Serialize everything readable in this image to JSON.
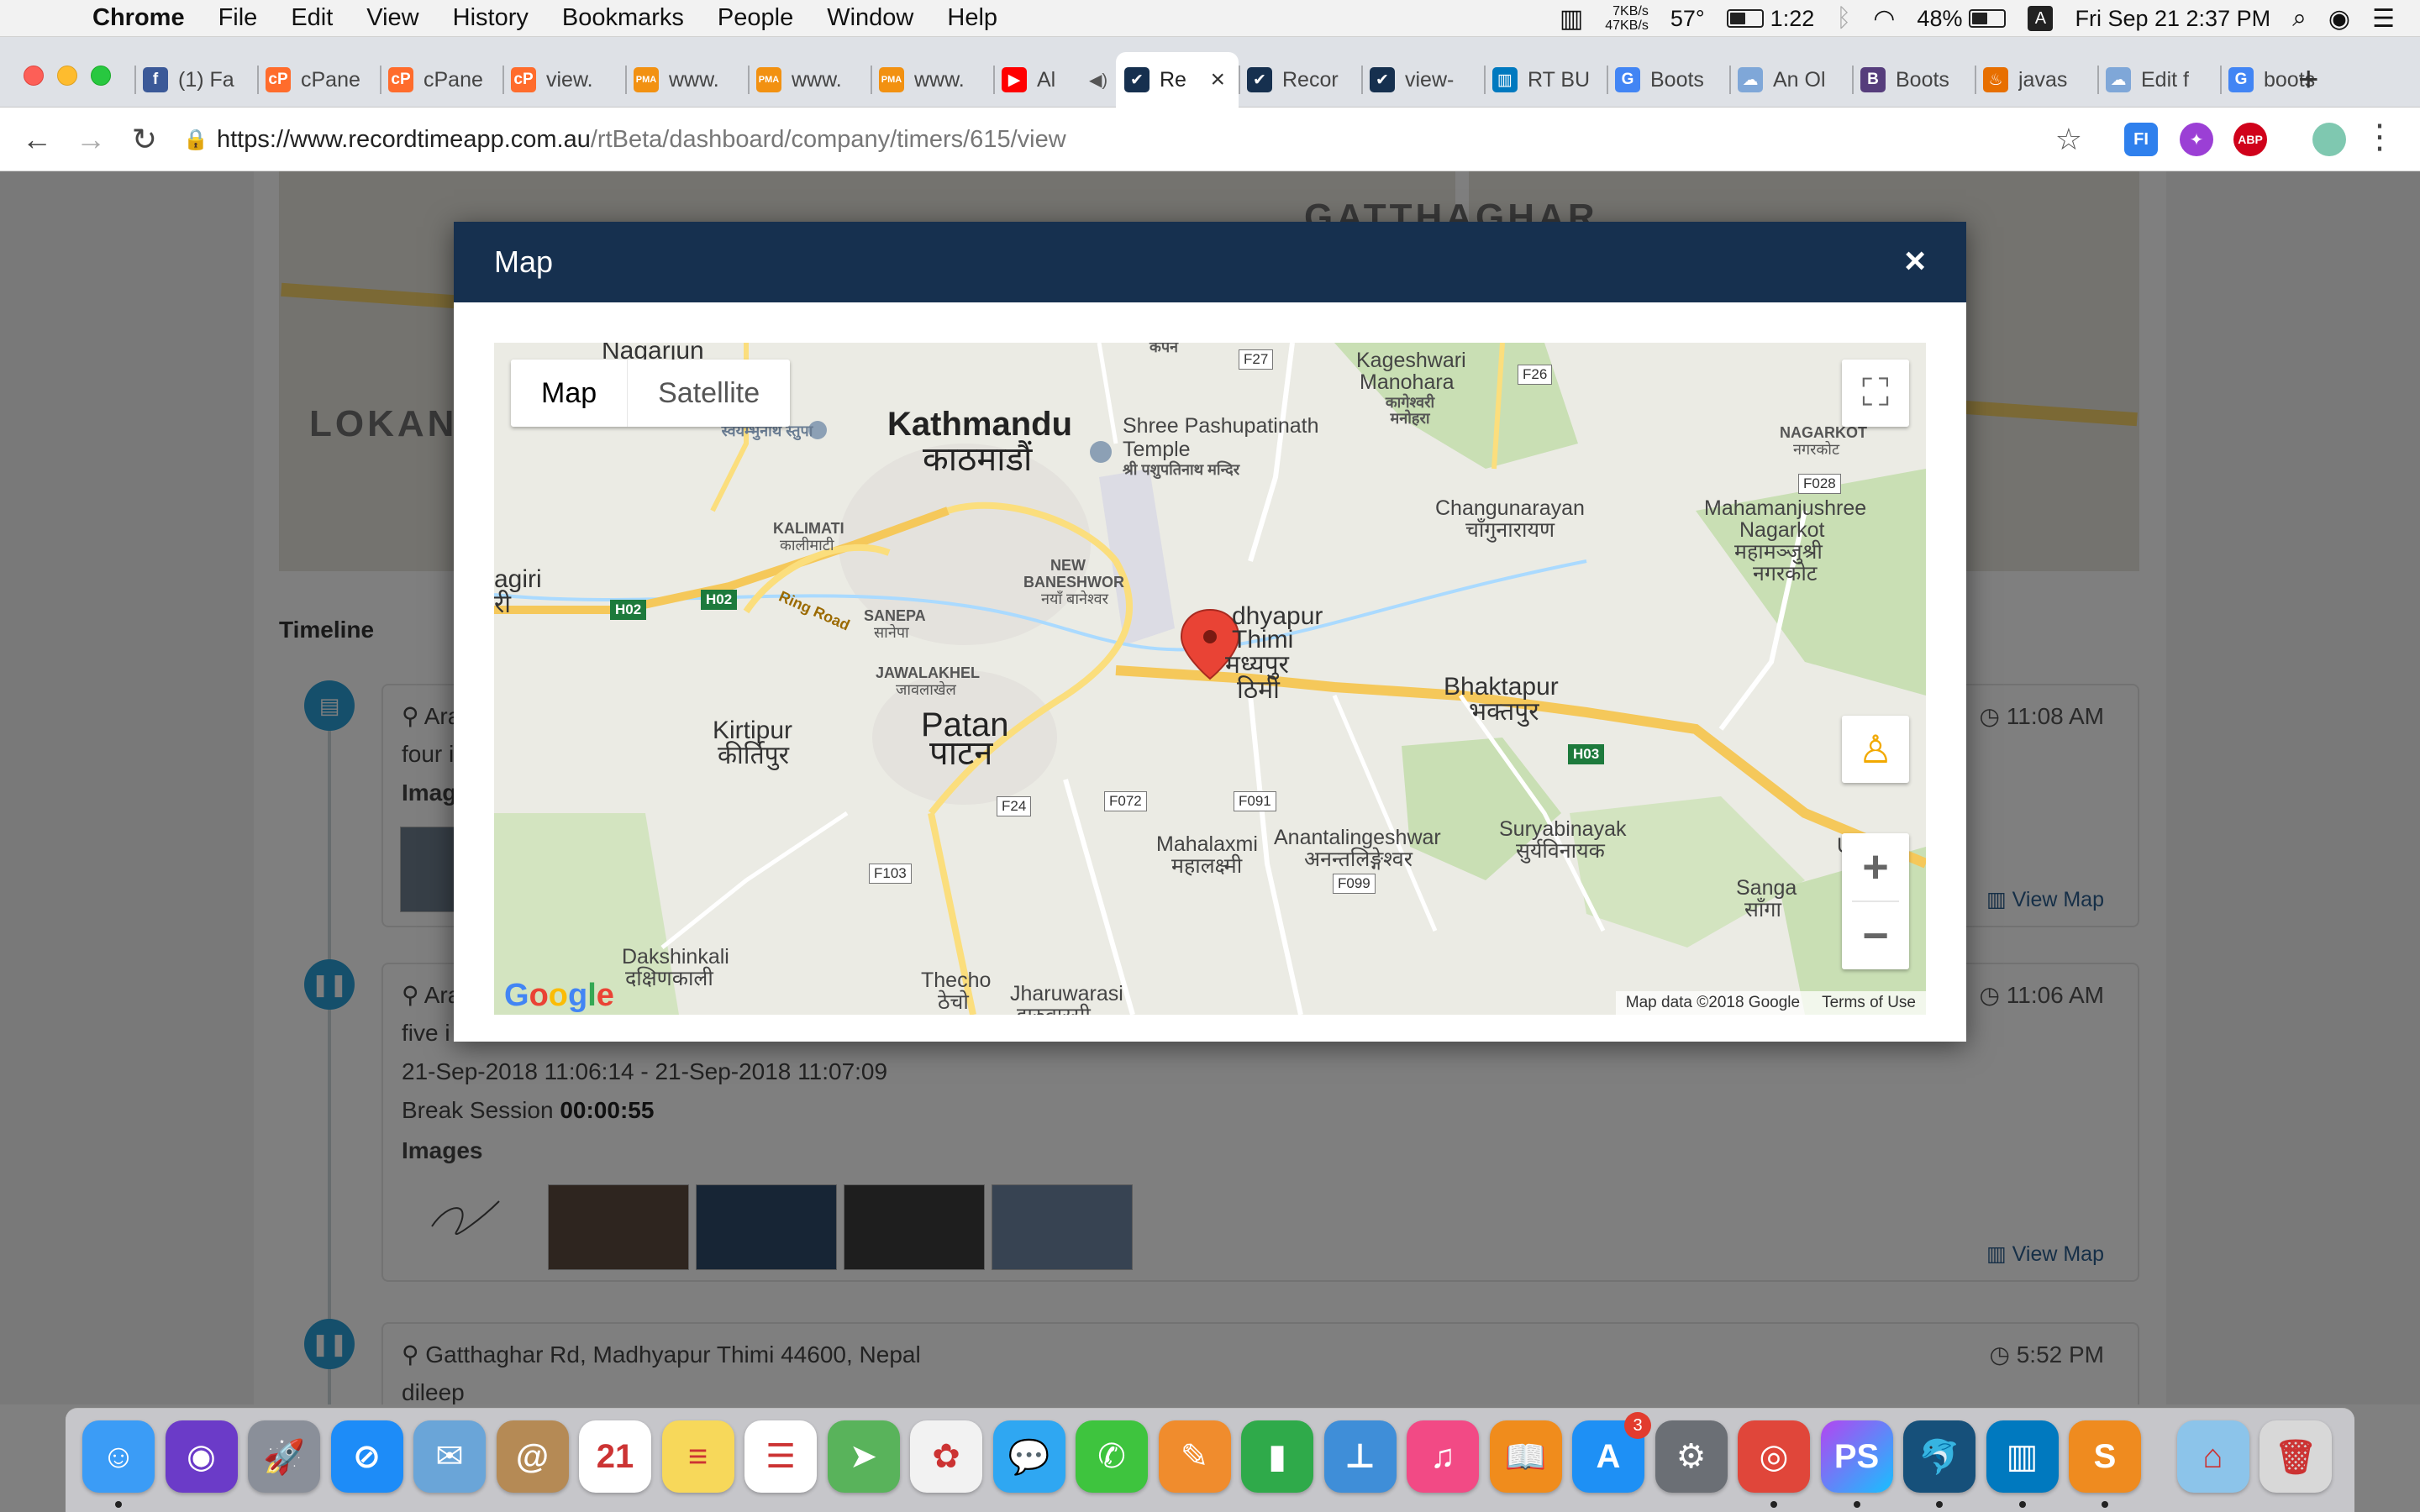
{
  "menubar": {
    "apple": "",
    "items": [
      "Chrome",
      "File",
      "Edit",
      "View",
      "History",
      "Bookmarks",
      "People",
      "Window",
      "Help"
    ],
    "netspeed_up": "7KB/s",
    "netspeed_down": "47KB/s",
    "temperature": "57°",
    "battery_time": "1:22",
    "battery_percent": "48%",
    "input_source": "A",
    "datetime": "Fri Sep 21  2:37 PM"
  },
  "tabs": [
    {
      "title": "(1) Fa",
      "favicon": "facebook-icon",
      "color": "#3b5998",
      "glyph": "f"
    },
    {
      "title": "cPane",
      "favicon": "cpanel-icon",
      "color": "#ff6c2c",
      "glyph": "cP"
    },
    {
      "title": "cPane",
      "favicon": "cpanel-icon",
      "color": "#ff6c2c",
      "glyph": "cP"
    },
    {
      "title": "view.",
      "favicon": "cpanel-icon",
      "color": "#ff6c2c",
      "glyph": "cP"
    },
    {
      "title": "www.",
      "favicon": "phpmyadmin-icon",
      "color": "#f29111",
      "glyph": "PMA"
    },
    {
      "title": "www.",
      "favicon": "phpmyadmin-icon",
      "color": "#f29111",
      "glyph": "PMA"
    },
    {
      "title": "www.",
      "favicon": "phpmyadmin-icon",
      "color": "#f29111",
      "glyph": "PMA"
    },
    {
      "title": "Al",
      "favicon": "youtube-icon",
      "color": "#ff0000",
      "glyph": "▶"
    },
    {
      "title": "Re",
      "favicon": "recordtime-icon",
      "color": "#16304f",
      "glyph": "✔",
      "active": true
    },
    {
      "title": "Recor",
      "favicon": "recordtime-icon",
      "color": "#16304f",
      "glyph": "✔"
    },
    {
      "title": "view-",
      "favicon": "recordtime-icon",
      "color": "#16304f",
      "glyph": "✔"
    },
    {
      "title": "RT BU",
      "favicon": "trello-icon",
      "color": "#0079bf",
      "glyph": "▥"
    },
    {
      "title": "Boots",
      "favicon": "google-icon",
      "color": "#4285f4",
      "glyph": "G"
    },
    {
      "title": "An Ol",
      "favicon": "cloud-icon",
      "color": "#7fa7d8",
      "glyph": "☁"
    },
    {
      "title": "Boots",
      "favicon": "bootstrap-icon",
      "color": "#563d7c",
      "glyph": "B"
    },
    {
      "title": "javas",
      "favicon": "java-icon",
      "color": "#e76f00",
      "glyph": "♨"
    },
    {
      "title": "Edit f",
      "favicon": "cloud-icon",
      "color": "#7fa7d8",
      "glyph": "☁"
    },
    {
      "title": "boots",
      "favicon": "google-icon",
      "color": "#4285f4",
      "glyph": "G"
    }
  ],
  "address": {
    "host": "https://www.recordtimeapp.com.au",
    "path": "/rtBeta/dashboard/company/timers/615/view"
  },
  "background_page": {
    "map_labels": [
      "GATTHAGHAR",
      "LOKAN"
    ],
    "timeline_title": "Timeline",
    "entries": [
      {
        "location": "Ara",
        "time": "11:08 AM",
        "line1": "four i",
        "images_label": "Image",
        "view_map": "View Map"
      },
      {
        "location": "Ara",
        "time": "11:06 AM",
        "line1": "five i",
        "range": "21-Sep-2018 11:06:14 - 21-Sep-2018 11:07:09",
        "break_label": "Break Session",
        "break_value": "00:00:55",
        "images_label": "Images",
        "view_map": "View Map"
      },
      {
        "location": "Gatthaghar Rd, Madhyapur Thimi 44600, Nepal",
        "time": "5:52 PM",
        "line1": "dileep"
      }
    ]
  },
  "modal": {
    "title": "Map",
    "close": "×",
    "map_type": {
      "map": "Map",
      "satellite": "Satellite"
    },
    "attribution": {
      "data": "Map data ©2018 Google",
      "terms": "Terms of Use"
    },
    "labels": {
      "nagarjun": "Nagarjun",
      "kathmandu": "Kathmandu",
      "kathmandu_ne": "काठमाडौं",
      "swayambhu": "स्वयम्भुनाथ स्तुपा",
      "pashupatinath": "Shree Pashupatinath",
      "temple": "Temple",
      "pashupatinath_ne": "श्री पशुपतिनाथ मन्दिर",
      "kageshwari": "Kageshwari",
      "manohara": "Manohara",
      "kageshwari_ne": "कागेश्वरी मनोहरा",
      "nagarkot_sm": "NAGARKOT",
      "nagarkot_sm_ne": "नगरकोट",
      "changunarayan": "Changunarayan",
      "changunarayan_ne": "चाँगुनारायण",
      "mahamanjushree": "Mahamanjushree",
      "nagarkot": "Nagarkot",
      "mahamanjushree_ne": "महामञ्जुश्री",
      "nagarkot_ne": "नगरकोट",
      "kalimati": "KALIMATI",
      "kalimati_ne": "कालीमाटी",
      "new_baneshwor": "NEW",
      "new_baneshwor2": "BANESHWOR",
      "new_baneshwor_ne": "नयाँ बानेश्वर",
      "nagiri": "agiri",
      "nagiri_ne": "री",
      "ring_road": "Ring Road",
      "sanepa": "SANEPA",
      "sanepa_ne": "सानेपा",
      "jawalakhel": "JAWALAKHEL",
      "jawalakhel_ne": "जावलाखेल",
      "madhyapur": "dhyapur",
      "thimi": "Thimi",
      "madhyapur_ne": "मध्यपुर",
      "thimi_ne": "ठिमी",
      "bhaktapur": "Bhaktapur",
      "bhaktapur_ne": "भक्तपुर",
      "kirtipur": "Kirtipur",
      "kirtipur_ne": "कीर्तिपुर",
      "patan": "Patan",
      "patan_ne": "पाटन",
      "mahalaxmi": "Mahalaxmi",
      "mahalaxmi_ne": "महालक्ष्मी",
      "anantalingeshwar": "Anantalingeshwar",
      "anantalingeshwar_ne": "अनन्तलिङ्गेश्वर",
      "suryabinayak": "Suryabinayak",
      "suryabinayak_ne": "सुर्यविनायक",
      "sanga": "Sanga",
      "sanga_ne": "साँगा",
      "dakshinkali": "Dakshinkali",
      "dakshinkali_ne": "दक्षिणकाली",
      "thecho": "Thecho",
      "thecho_ne": "ठेचो",
      "jharuwarasi": "Jharuwarasi",
      "jharuwarasi_ne": "झरुवारसी",
      "ugrachandi": "U",
      "kapan": "कपन"
    },
    "shields": [
      "F27",
      "F26",
      "F028",
      "H02",
      "H02",
      "H03",
      "F24",
      "F072",
      "F091",
      "F103",
      "F099"
    ]
  },
  "dock": [
    {
      "name": "finder-icon",
      "color": "#3b9cf6",
      "glyph": "☺",
      "running": true
    },
    {
      "name": "siri-icon",
      "color": "#6b3bc8",
      "glyph": "◉"
    },
    {
      "name": "launchpad-icon",
      "color": "#8a8f99",
      "glyph": "🚀"
    },
    {
      "name": "safari-icon",
      "color": "#1d8cf8",
      "glyph": "⊘"
    },
    {
      "name": "mail-icon",
      "color": "#6aa5d8",
      "glyph": "✉"
    },
    {
      "name": "contacts-icon",
      "color": "#b58a55",
      "glyph": "@"
    },
    {
      "name": "calendar-icon",
      "color": "#ffffff",
      "glyph": "21"
    },
    {
      "name": "notes-icon",
      "color": "#f7d85a",
      "glyph": "≡"
    },
    {
      "name": "reminders-icon",
      "color": "#ffffff",
      "glyph": "☰"
    },
    {
      "name": "maps-icon",
      "color": "#59b35b",
      "glyph": "➤"
    },
    {
      "name": "photos-icon",
      "color": "#f2f2f2",
      "glyph": "✿"
    },
    {
      "name": "messages-icon",
      "color": "#2fa7f2",
      "glyph": "💬"
    },
    {
      "name": "facetime-icon",
      "color": "#3ec43e",
      "glyph": "✆"
    },
    {
      "name": "pages-icon",
      "color": "#f08c2d",
      "glyph": "✎"
    },
    {
      "name": "numbers-icon",
      "color": "#2faa4a",
      "glyph": "▮"
    },
    {
      "name": "keynote-icon",
      "color": "#3f8ed8",
      "glyph": "⊥"
    },
    {
      "name": "itunes-icon",
      "color": "#f24a85",
      "glyph": "♫"
    },
    {
      "name": "ibooks-icon",
      "color": "#f08c1c",
      "glyph": "📖"
    },
    {
      "name": "app-store-icon",
      "color": "#1e90f5",
      "glyph": "A",
      "badge": "3"
    },
    {
      "name": "system-preferences-icon",
      "color": "#6b6f75",
      "glyph": "⚙"
    },
    {
      "name": "chrome-icon",
      "color": "#e0463a",
      "glyph": "◎",
      "running": true
    },
    {
      "name": "phpstorm-icon",
      "color": "#b345f1",
      "glyph": "PS",
      "running": true
    },
    {
      "name": "mysql-workbench-icon",
      "color": "#16507a",
      "glyph": "🐬",
      "running": true
    },
    {
      "name": "trello-icon",
      "color": "#0079bf",
      "glyph": "▥",
      "running": true
    },
    {
      "name": "sublime-text-icon",
      "color": "#ef8b1f",
      "glyph": "S",
      "running": true
    },
    {
      "name": "downloads-folder-icon",
      "color": "#8cc4ea",
      "glyph": "⌂"
    },
    {
      "name": "trash-icon",
      "color": "#d8d8d8",
      "glyph": "🗑"
    }
  ]
}
